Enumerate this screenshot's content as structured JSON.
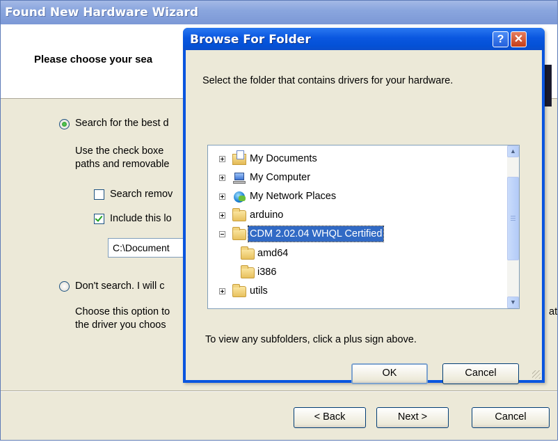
{
  "wizard": {
    "title": "Found New Hardware Wizard",
    "heading": "Please choose your sea",
    "option_search": "Search for the best d",
    "option_search_desc_1": "Use the check boxe",
    "option_search_desc_2": "paths and removable",
    "checkbox_removable": "Search remov",
    "checkbox_include": "Include this lo",
    "path_value": "C:\\Document",
    "option_dont": "Don't search. I will c",
    "option_dont_desc_1": "Choose this option to",
    "option_dont_desc_2": "the driver you choos",
    "option_dont_desc_tail": "at",
    "back_label": "< Back",
    "next_label": "Next >",
    "cancel_label": "Cancel"
  },
  "dialog": {
    "title": "Browse For Folder",
    "help_label": "?",
    "close_label": "✕",
    "prompt": "Select the folder that contains drivers for your hardware.",
    "tree": [
      {
        "label": "My Documents",
        "icon": "my-documents-icon",
        "expander": "plus"
      },
      {
        "label": "My Computer",
        "icon": "my-computer-icon",
        "expander": "plus"
      },
      {
        "label": "My Network Places",
        "icon": "network-places-icon",
        "expander": "plus"
      },
      {
        "label": "arduino",
        "icon": "folder-icon",
        "expander": "plus"
      },
      {
        "label": "CDM 2.02.04 WHQL Certified",
        "icon": "folder-open-icon",
        "expander": "minus",
        "selected": true
      },
      {
        "label": "amd64",
        "icon": "folder-icon",
        "expander": "none"
      },
      {
        "label": "i386",
        "icon": "folder-icon",
        "expander": "none"
      },
      {
        "label": "utils",
        "icon": "folder-icon",
        "expander": "plus"
      }
    ],
    "hint": "To view any subfolders, click a plus sign above.",
    "ok_label": "OK",
    "cancel_label": "Cancel"
  },
  "colors": {
    "dialog_title_blue": "#0a57e0",
    "selection_blue": "#316ac5",
    "xp_face": "#ece9d8"
  }
}
